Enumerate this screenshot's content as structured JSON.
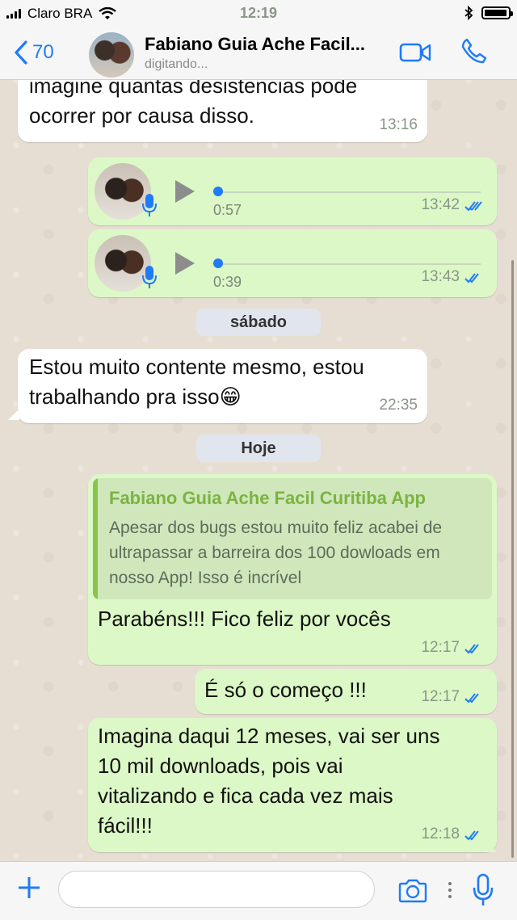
{
  "status_bar": {
    "carrier": "Claro BRA",
    "time": "12:19",
    "battery_level": 0.95
  },
  "header": {
    "back_count": "70",
    "contact_name": "Fabiano Guia Ache Facil...",
    "status": "digitando..."
  },
  "messages": {
    "m1": {
      "text_line1": "imagine quantas desistencias pode",
      "text_line2": "ocorrer por causa disso.",
      "time": "13:16"
    },
    "voice1": {
      "duration": "0:57",
      "time": "13:42"
    },
    "voice2": {
      "duration": "0:39",
      "time": "13:43"
    },
    "day1": "sábado",
    "m2": {
      "text_line1": "Estou muito contente mesmo, estou",
      "text_line2": "trabalhando pra isso😁",
      "time": "22:35"
    },
    "day2": "Hoje",
    "m3": {
      "quote_name": "Fabiano Guia Ache Facil Curitiba App",
      "quote_line1": "Apesar dos bugs estou muito feliz acabei de",
      "quote_line2": "ultrapassar a barreira dos 100 dowloads em",
      "quote_line3": "nosso App! Isso é incrível",
      "text": "Parabéns!!! Fico feliz por vocês",
      "time": "12:17"
    },
    "m4": {
      "text": "É só o começo !!!",
      "time": "12:17"
    },
    "m5": {
      "line1": "Imagina daqui 12 meses, vai ser uns",
      "line2": "10 mil downloads, pois vai",
      "line3": "vitalizando e fica cada vez mais",
      "line4": "fácil!!!",
      "time": "12:18"
    }
  },
  "composer": {
    "placeholder": ""
  },
  "colors": {
    "accent": "#1f7bf6",
    "outgoing": "#dcf8c6",
    "incoming": "#ffffff",
    "quote_name": "#7cb342"
  },
  "icons": [
    "signal-bars-icon",
    "wifi-icon",
    "bluetooth-icon",
    "battery-icon",
    "chevron-left-icon",
    "video-call-icon",
    "phone-icon",
    "play-icon",
    "mic-icon",
    "double-check-icon",
    "plus-icon",
    "camera-icon",
    "more-icon"
  ]
}
